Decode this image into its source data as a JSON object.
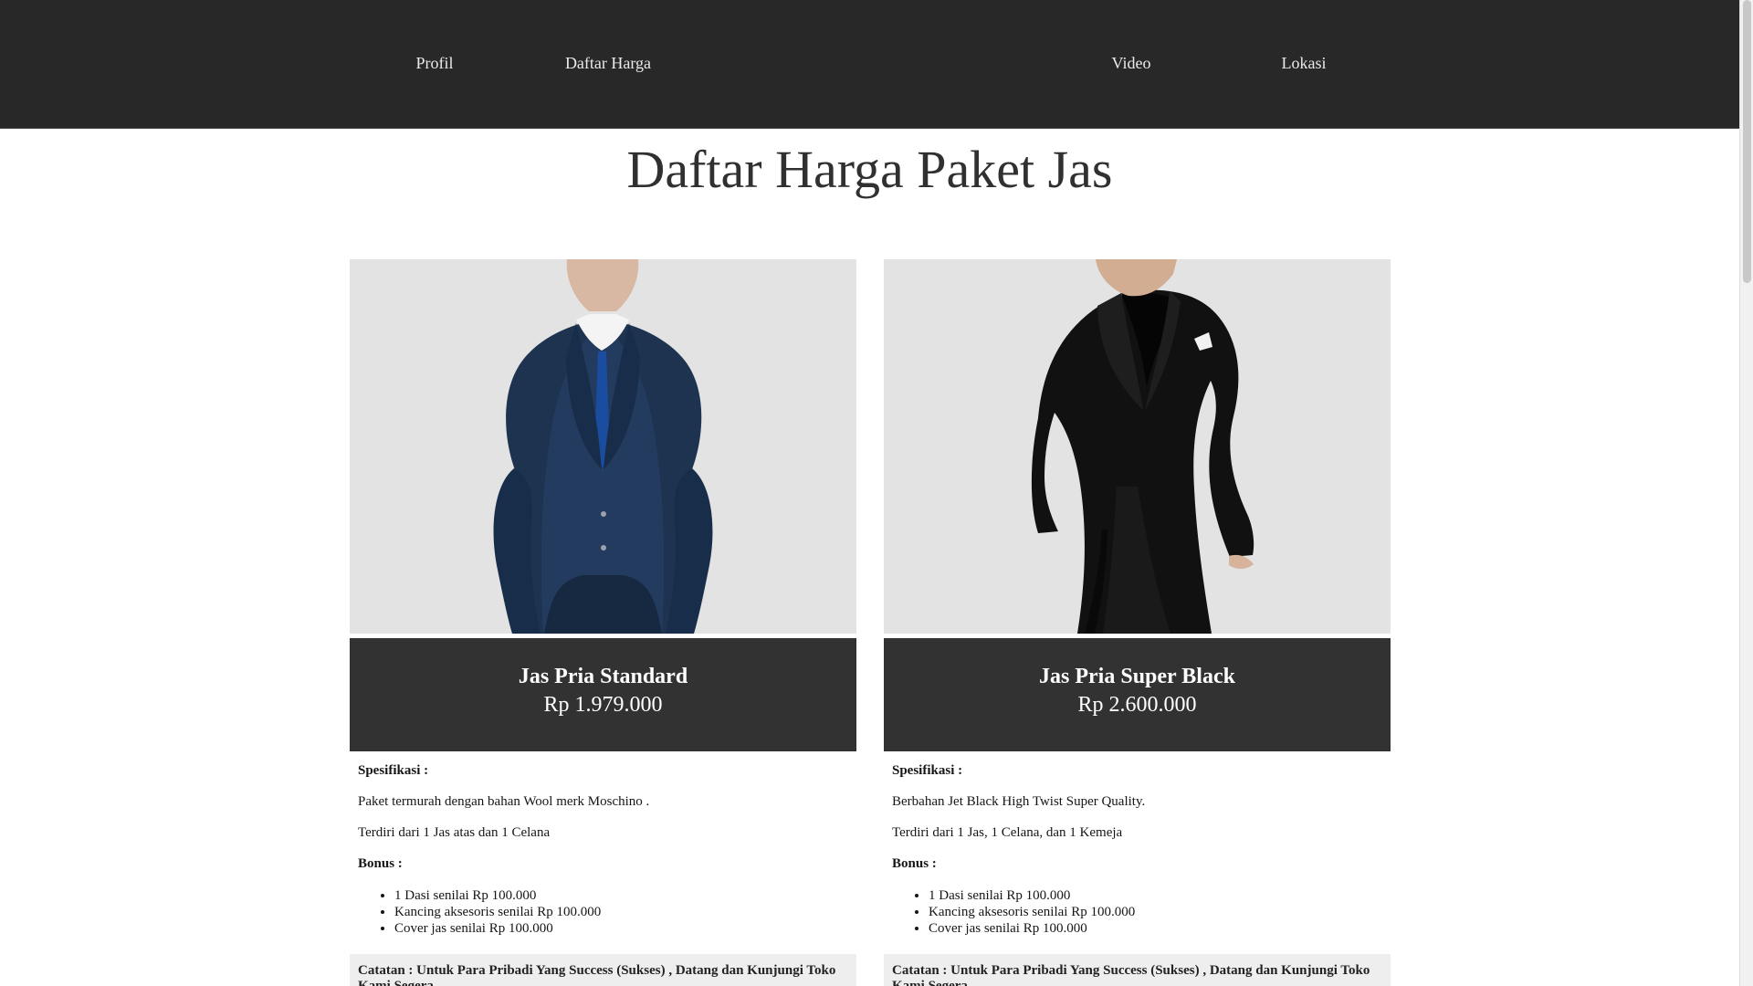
{
  "nav": {
    "items": [
      {
        "label": "Profil"
      },
      {
        "label": "Daftar Harga"
      },
      {
        "label": "Video"
      },
      {
        "label": "Lokasi"
      }
    ]
  },
  "page": {
    "title": "Daftar Harga Paket Jas"
  },
  "products": [
    {
      "name": "Jas Pria Standard",
      "price": "Rp 1.979.000",
      "spec_heading": "Spesifikasi :",
      "spec_lines": [
        "Paket termurah dengan bahan Wool merk  Moschino .",
        "Terdiri dari 1 Jas atas dan 1 Celana"
      ],
      "bonus_heading": "Bonus :",
      "bonus_items": [
        "1 Dasi senilai Rp 100.000",
        "Kancing aksesoris senilai Rp 100.000",
        "Cover jas senilai Rp 100.000"
      ],
      "note": "Catatan : Untuk Para Pribadi Yang Success (Sukses) , Datang dan Kunjungi Toko Kami Segera"
    },
    {
      "name": "Jas Pria Super Black",
      "price": "Rp 2.600.000",
      "spec_heading": "Spesifikasi :",
      "spec_lines": [
        "Berbahan Jet Black High Twist Super Quality.",
        "Terdiri dari 1 Jas, 1 Celana, dan 1 Kemeja"
      ],
      "bonus_heading": "Bonus :",
      "bonus_items": [
        "1 Dasi senilai Rp 100.000",
        "Kancing aksesoris senilai Rp 100.000",
        "Cover jas senilai Rp 100.000"
      ],
      "note": "Catatan : Untuk Para Pribadi Yang Success (Sukses) , Datang dan Kunjungi Toko Kami Segera"
    }
  ],
  "theme": {
    "navbar_color": "#282828",
    "price_panel_color": "#323232",
    "image_background": "#e3e3e3"
  }
}
